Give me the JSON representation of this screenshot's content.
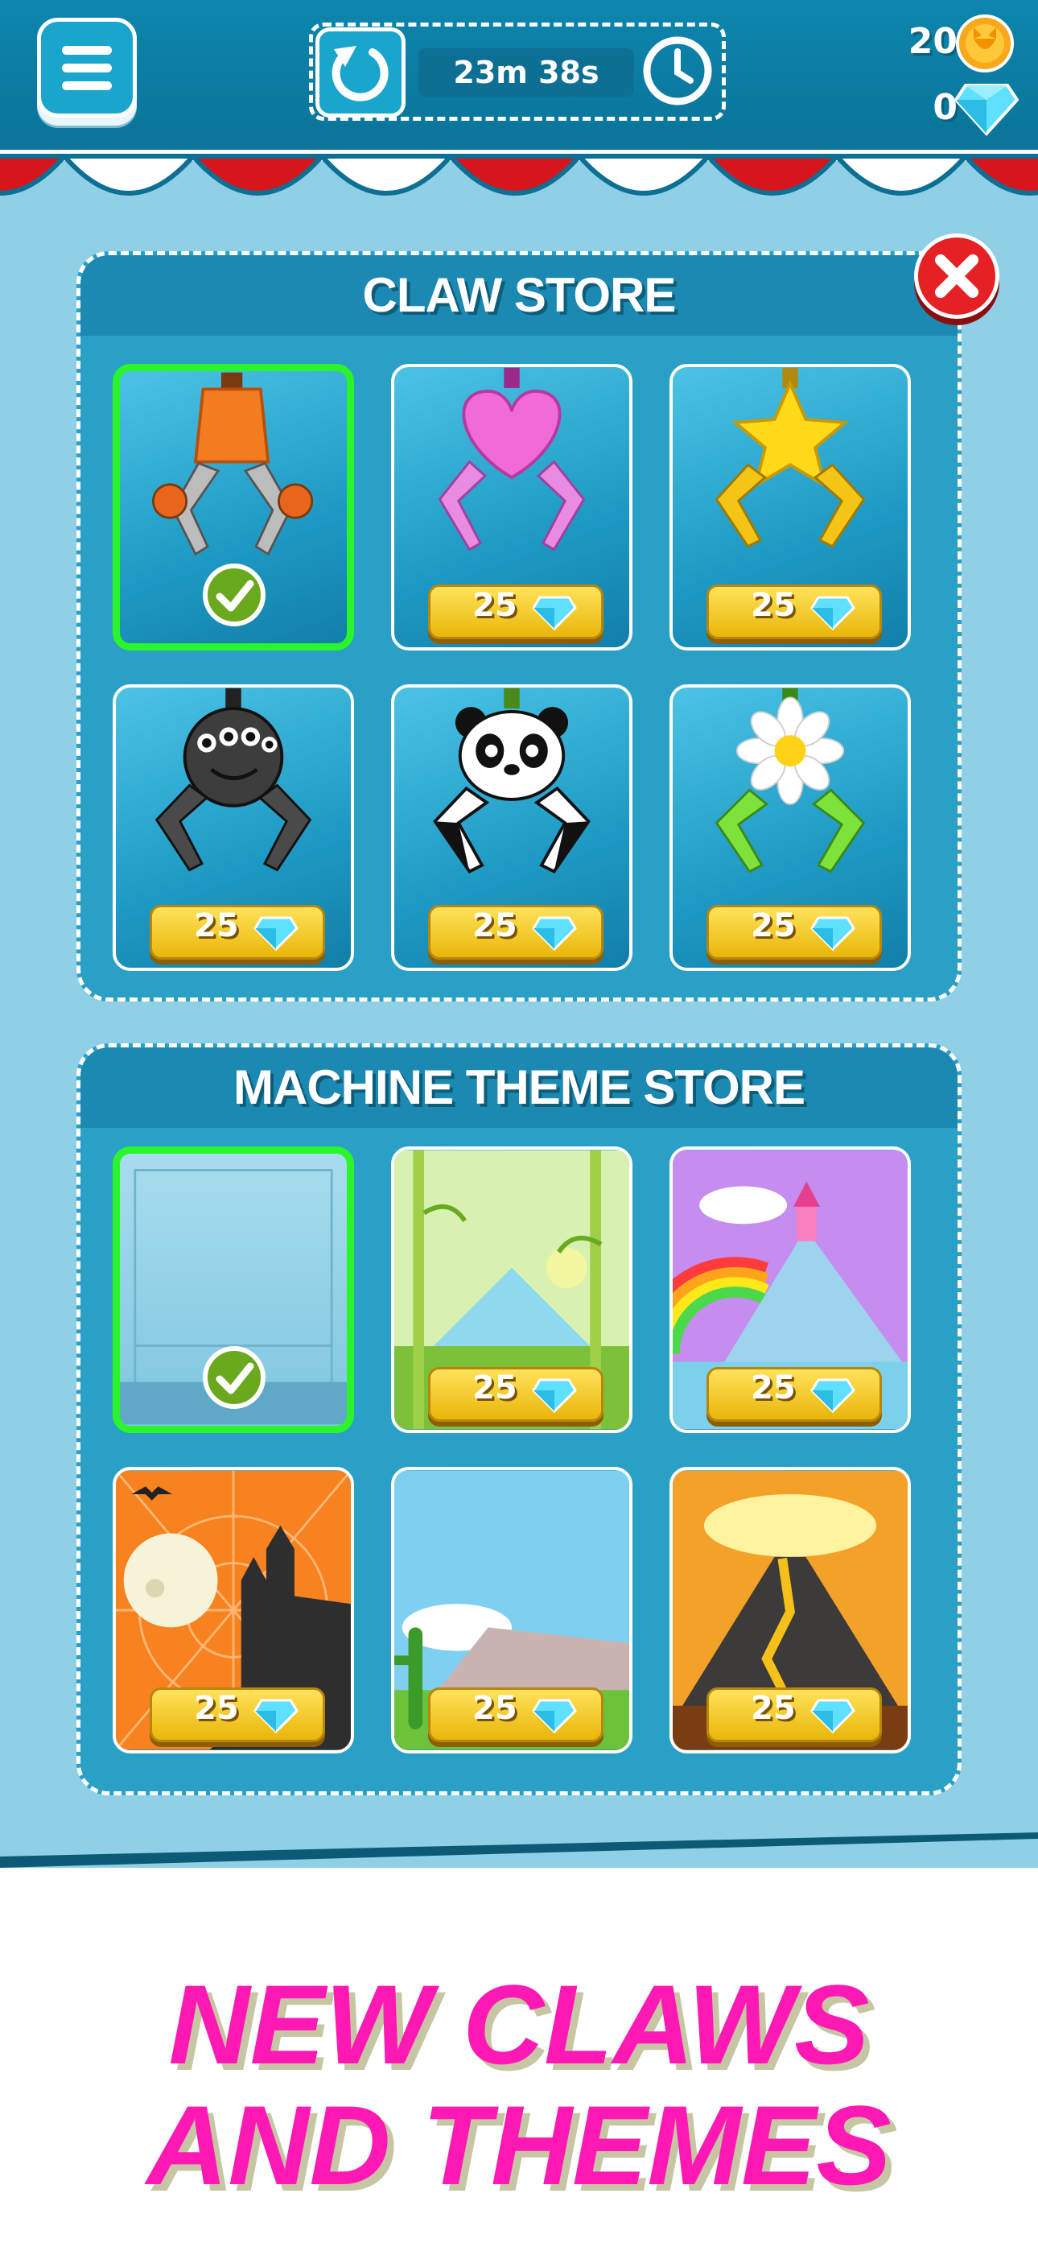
{
  "header": {
    "timer": "23m 38s",
    "coins": "20",
    "gems": "0"
  },
  "claw_store": {
    "title": "CLAW STORE",
    "items": [
      {
        "name": "orange-claw",
        "selected": true
      },
      {
        "name": "heart-claw",
        "price": "25"
      },
      {
        "name": "star-claw",
        "price": "25"
      },
      {
        "name": "spider-claw",
        "price": "25"
      },
      {
        "name": "panda-claw",
        "price": "25"
      },
      {
        "name": "daisy-claw",
        "price": "25"
      }
    ]
  },
  "theme_store": {
    "title": "MACHINE THEME STORE",
    "items": [
      {
        "name": "classic-theme",
        "selected": true
      },
      {
        "name": "bamboo-theme",
        "price": "25"
      },
      {
        "name": "rainbow-castle-theme",
        "price": "25"
      },
      {
        "name": "halloween-theme",
        "price": "25"
      },
      {
        "name": "desert-theme",
        "price": "25"
      },
      {
        "name": "volcano-theme",
        "price": "25"
      }
    ]
  },
  "promo": {
    "line1": "NEW CLAWS",
    "line2": "AND THEMES"
  },
  "colors": {
    "background": "#8fd0e6",
    "topbar": "#0d86ad",
    "panel": "#2aa0c6",
    "selected_border": "#2af52a",
    "price_gold": "#f5c518",
    "close_red": "#e52125",
    "promo_pink": "#ff19b4"
  },
  "icons": [
    "menu-icon",
    "undo-icon",
    "clock-icon",
    "coin-icon",
    "gem-icon",
    "close-icon",
    "check-icon"
  ]
}
